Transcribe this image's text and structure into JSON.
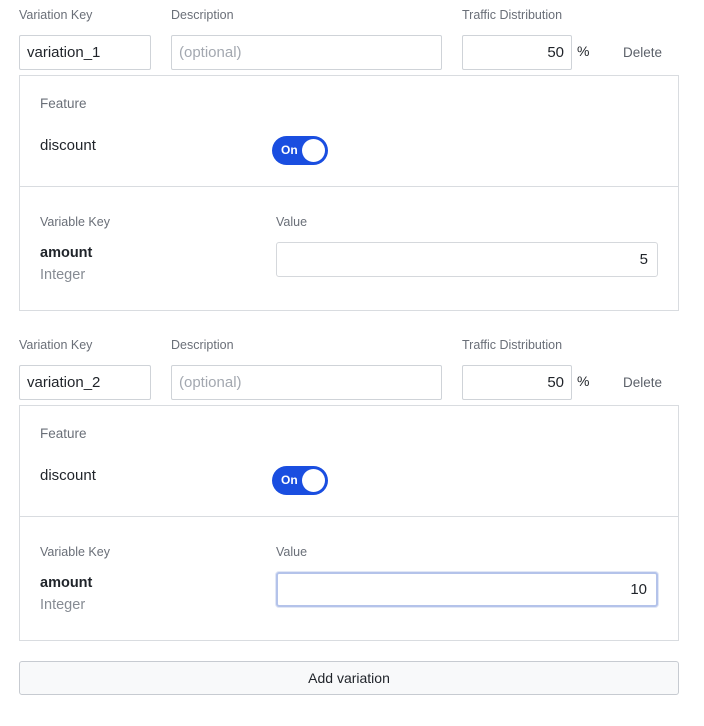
{
  "labels": {
    "variation_key": "Variation Key",
    "description": "Description",
    "traffic_distribution": "Traffic Distribution",
    "percent": "%",
    "delete": "Delete",
    "feature": "Feature",
    "variable_key": "Variable Key",
    "value": "Value",
    "toggle_on": "On"
  },
  "variations": [
    {
      "key": "variation_1",
      "description_placeholder": "(optional)",
      "traffic": "50",
      "feature_name": "discount",
      "feature_enabled": true,
      "variable_key": "amount",
      "variable_type": "Integer",
      "variable_value": "5"
    },
    {
      "key": "variation_2",
      "description_placeholder": "(optional)",
      "traffic": "50",
      "feature_name": "discount",
      "feature_enabled": true,
      "variable_key": "amount",
      "variable_type": "Integer",
      "variable_value": "10"
    }
  ],
  "add_variation_label": "Add variation",
  "colors": {
    "toggle_on": "#1a4ee0",
    "focus_ring": "#b4c3ea"
  }
}
